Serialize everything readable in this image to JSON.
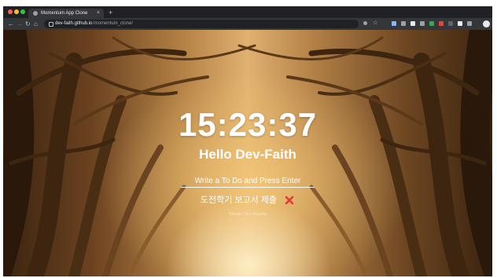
{
  "browser": {
    "tab_title": "Momentum App Clone",
    "tab_close": "×",
    "new_tab": "+",
    "url_host": "dev-faith.github.io",
    "url_path": "/momentum_clone/"
  },
  "app": {
    "clock": "15:23:37",
    "greeting": "Hello Dev-Faith",
    "todo_placeholder": "Write a To Do and Press Enter",
    "todos": [
      {
        "text": "도전학기 보고서 제출"
      }
    ],
    "weather": "Clouds / 19.7 Hayang"
  },
  "colors": {
    "delete_icon": "#e53935"
  }
}
